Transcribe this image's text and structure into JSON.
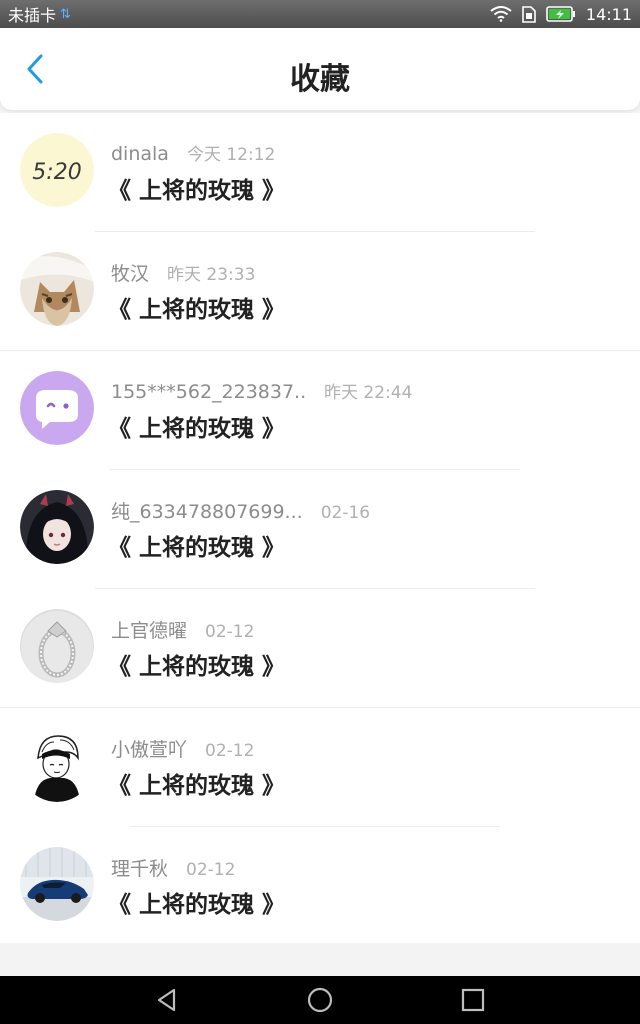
{
  "status_bar": {
    "carrier": "未插卡",
    "time": "14:11"
  },
  "header": {
    "title": "收藏"
  },
  "favorites": [
    {
      "author": "dinala",
      "time": "今天 12:12",
      "title": "《 上将的玫瑰 》",
      "avatar_text": "5:20"
    },
    {
      "author": "牧汉",
      "time": "昨天 23:33",
      "title": "《 上将的玫瑰 》"
    },
    {
      "author": "155***562_223837...",
      "time": "昨天 22:44",
      "title": "《 上将的玫瑰 》"
    },
    {
      "author": "纯_633478807699...",
      "time": "02-16",
      "title": "《 上将的玫瑰 》"
    },
    {
      "author": "上官德曜",
      "time": "02-12",
      "title": "《 上将的玫瑰 》"
    },
    {
      "author": "小傲萱吖",
      "time": "02-12",
      "title": "《 上将的玫瑰 》"
    },
    {
      "author": "理千秋",
      "time": "02-12",
      "title": "《 上将的玫瑰 》"
    }
  ],
  "colors": {
    "accent": "#1e9be8",
    "title_text": "#222222",
    "meta_text": "#8c8c8c"
  }
}
